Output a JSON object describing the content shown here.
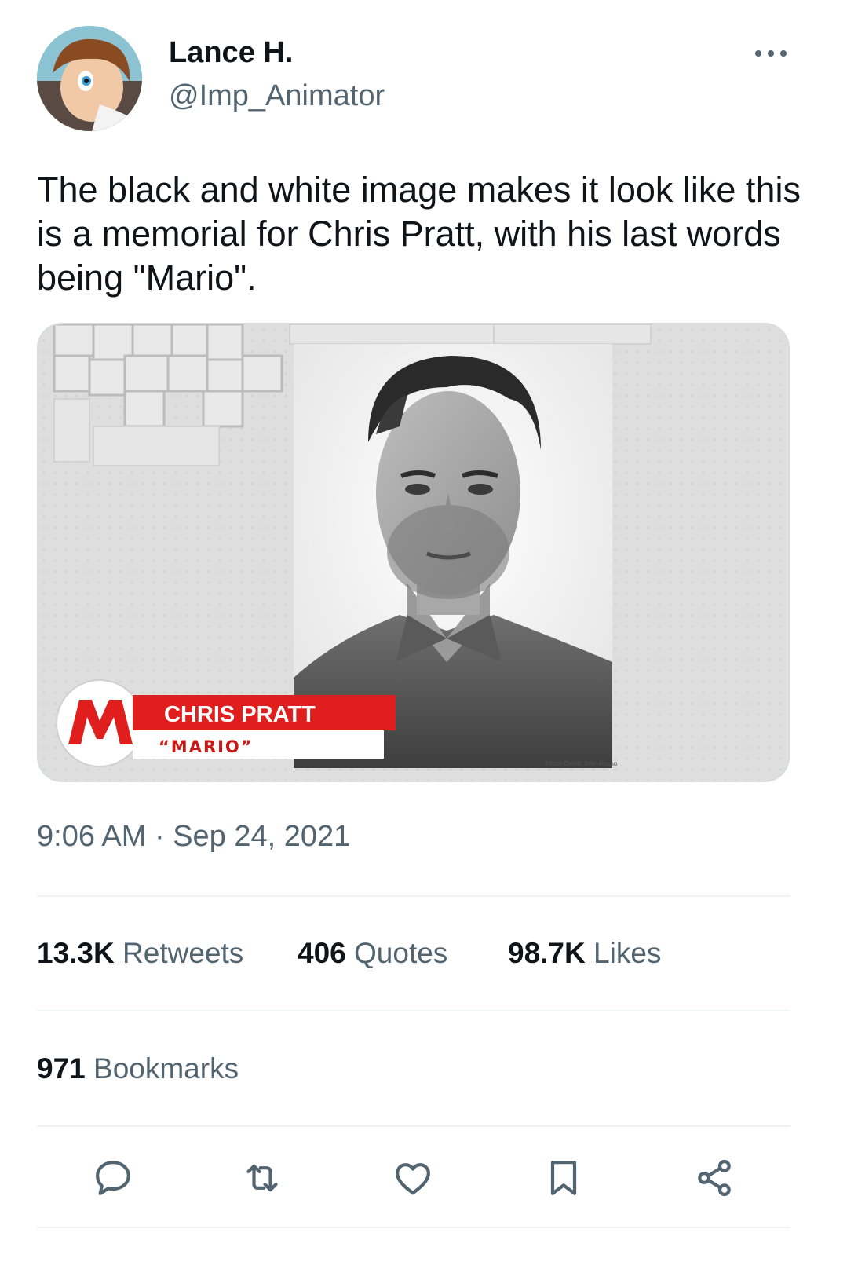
{
  "author": {
    "display_name": "Lance H.",
    "handle": "@Imp_Animator",
    "avatar_icon": "cartoon-character-avatar"
  },
  "tweet": {
    "text": "The black and white image makes it look like this is a memorial for Chris Pratt, with his last words being \"Mario\".",
    "timestamp": "9:06 AM · Sep 24, 2021"
  },
  "media": {
    "banner_name": "CHRIS PRATT",
    "banner_role": "“MARIO”",
    "logo_letter": "M",
    "photo_credit": "Photo Credit: John Russo",
    "accent_red": "#e01e1e"
  },
  "stats": {
    "retweets_count": "13.3K",
    "retweets_label": "Retweets",
    "quotes_count": "406",
    "quotes_label": "Quotes",
    "likes_count": "98.7K",
    "likes_label": "Likes",
    "bookmarks_count": "971",
    "bookmarks_label": "Bookmarks"
  },
  "actions": [
    "reply-icon",
    "retweet-icon",
    "like-icon",
    "bookmark-icon",
    "share-icon"
  ],
  "colors": {
    "text_primary": "#0f1419",
    "text_secondary": "#536471",
    "divider": "#eff3f4"
  }
}
